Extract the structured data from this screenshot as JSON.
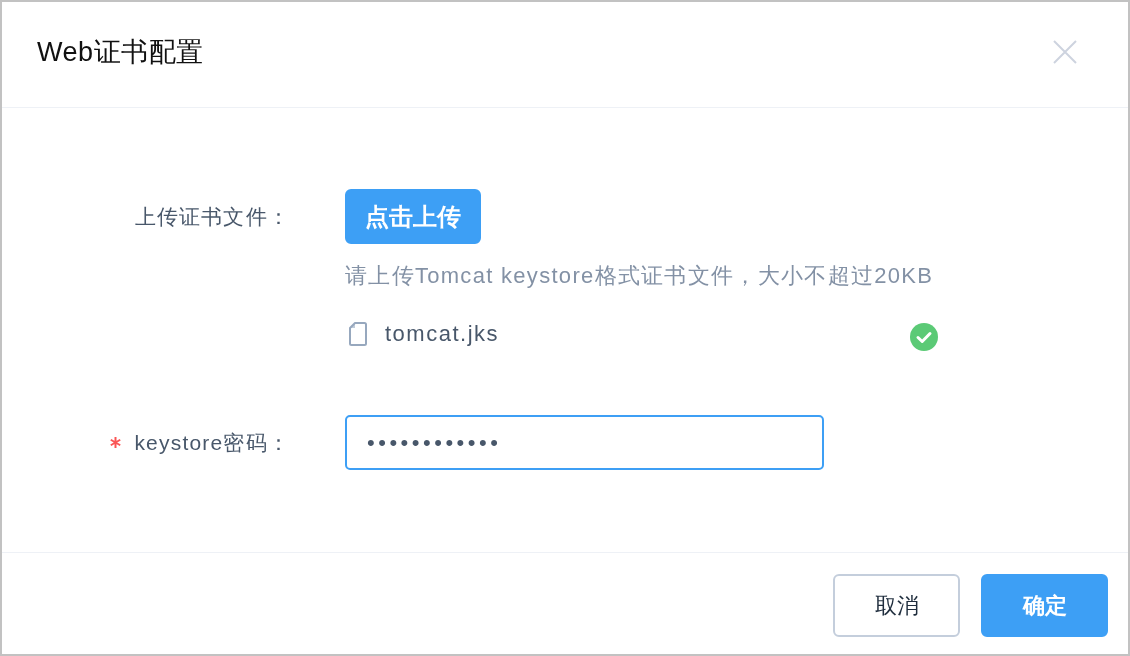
{
  "dialog": {
    "title": "Web证书配置"
  },
  "fields": [
    {
      "kind": "upload",
      "label": "上传证书文件：",
      "required": false,
      "button": "点击上传",
      "hint": "请上传Tomcat keystore格式证书文件，大小不超过20KB",
      "files": [
        {
          "name": "tomcat.jks",
          "uploaded": true
        }
      ]
    },
    {
      "kind": "password",
      "label": "keystore密码：",
      "required": true,
      "value": "••••••••••••",
      "focused": true
    }
  ],
  "buttons": [
    {
      "label": "取消",
      "kind": "default"
    },
    {
      "label": "确定",
      "kind": "primary"
    }
  ]
}
